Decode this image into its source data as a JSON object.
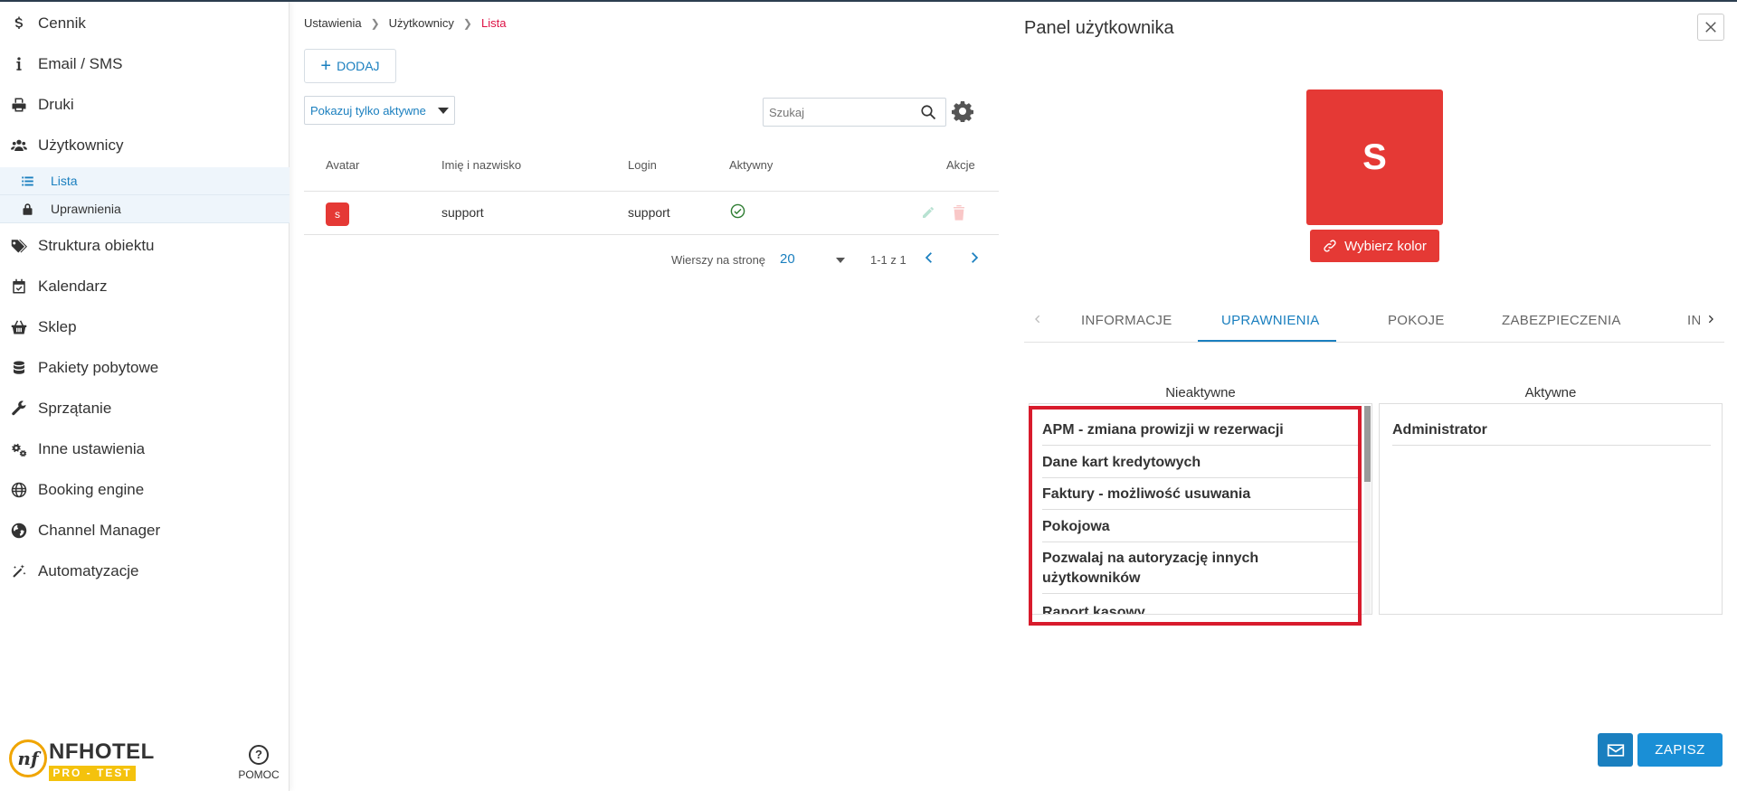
{
  "sidebar": {
    "items": [
      {
        "label": "Cennik",
        "icon": "dollar-icon"
      },
      {
        "label": "Email / SMS",
        "icon": "info-icon"
      },
      {
        "label": "Druki",
        "icon": "printer-icon"
      },
      {
        "label": "Użytkownicy",
        "icon": "users-icon"
      },
      {
        "label": "Struktura obiektu",
        "icon": "tags-icon"
      },
      {
        "label": "Kalendarz",
        "icon": "calendar-check-icon"
      },
      {
        "label": "Sklep",
        "icon": "basket-icon"
      },
      {
        "label": "Pakiety pobytowe",
        "icon": "database-icon"
      },
      {
        "label": "Sprzątanie",
        "icon": "wrench-icon"
      },
      {
        "label": "Inne ustawienia",
        "icon": "gears-icon"
      },
      {
        "label": "Booking engine",
        "icon": "globe-icon"
      },
      {
        "label": "Channel Manager",
        "icon": "globe-americas-icon"
      },
      {
        "label": "Automatyzacje",
        "icon": "magic-wand-icon"
      }
    ],
    "sub_items": [
      {
        "label": "Lista",
        "icon": "list-icon"
      },
      {
        "label": "Uprawnienia",
        "icon": "lock-icon"
      }
    ],
    "logo": {
      "mark": "nf",
      "brand": "NFHOTEL",
      "badge": "PRO - TEST"
    },
    "help_label": "POMOC"
  },
  "main": {
    "breadcrumb": [
      "Ustawienia",
      "Użytkownicy",
      "Lista"
    ],
    "add_button": "DODAJ",
    "filter_label": "Pokazuj tylko aktywne",
    "search_placeholder": "Szukaj",
    "table": {
      "headers": [
        "Avatar",
        "Imię i nazwisko",
        "Login",
        "Aktywny",
        "Akcje"
      ],
      "rows": [
        {
          "avatar_letter": "s",
          "name": "support",
          "login": "support"
        }
      ]
    },
    "pagination": {
      "rows_label": "Wierszy na stronę",
      "rows_value": "20",
      "range": "1-1 z 1"
    }
  },
  "panel": {
    "title": "Panel użytkownika",
    "avatar_letter": "S",
    "color_button": "Wybierz kolor",
    "tabs": [
      "INFORMACJE",
      "UPRAWNIENIA",
      "POKOJE",
      "ZABEZPIECZENIA",
      "IN"
    ],
    "inactive_title": "Nieaktywne",
    "active_title": "Aktywne",
    "inactive_items": [
      "APM - zmiana prowizji w rezerwacji",
      "Dane kart kredytowych",
      "Faktury - możliwość usuwania",
      "Pokojowa",
      "Pozwalaj na autoryzację innych użytkowników",
      "Raport kasowy"
    ],
    "active_items": [
      "Administrator"
    ],
    "save_button": "ZAPISZ"
  },
  "colors": {
    "accent": "#1a7fbf",
    "avatar": "#e53935",
    "highlight": "#d81b2c"
  }
}
